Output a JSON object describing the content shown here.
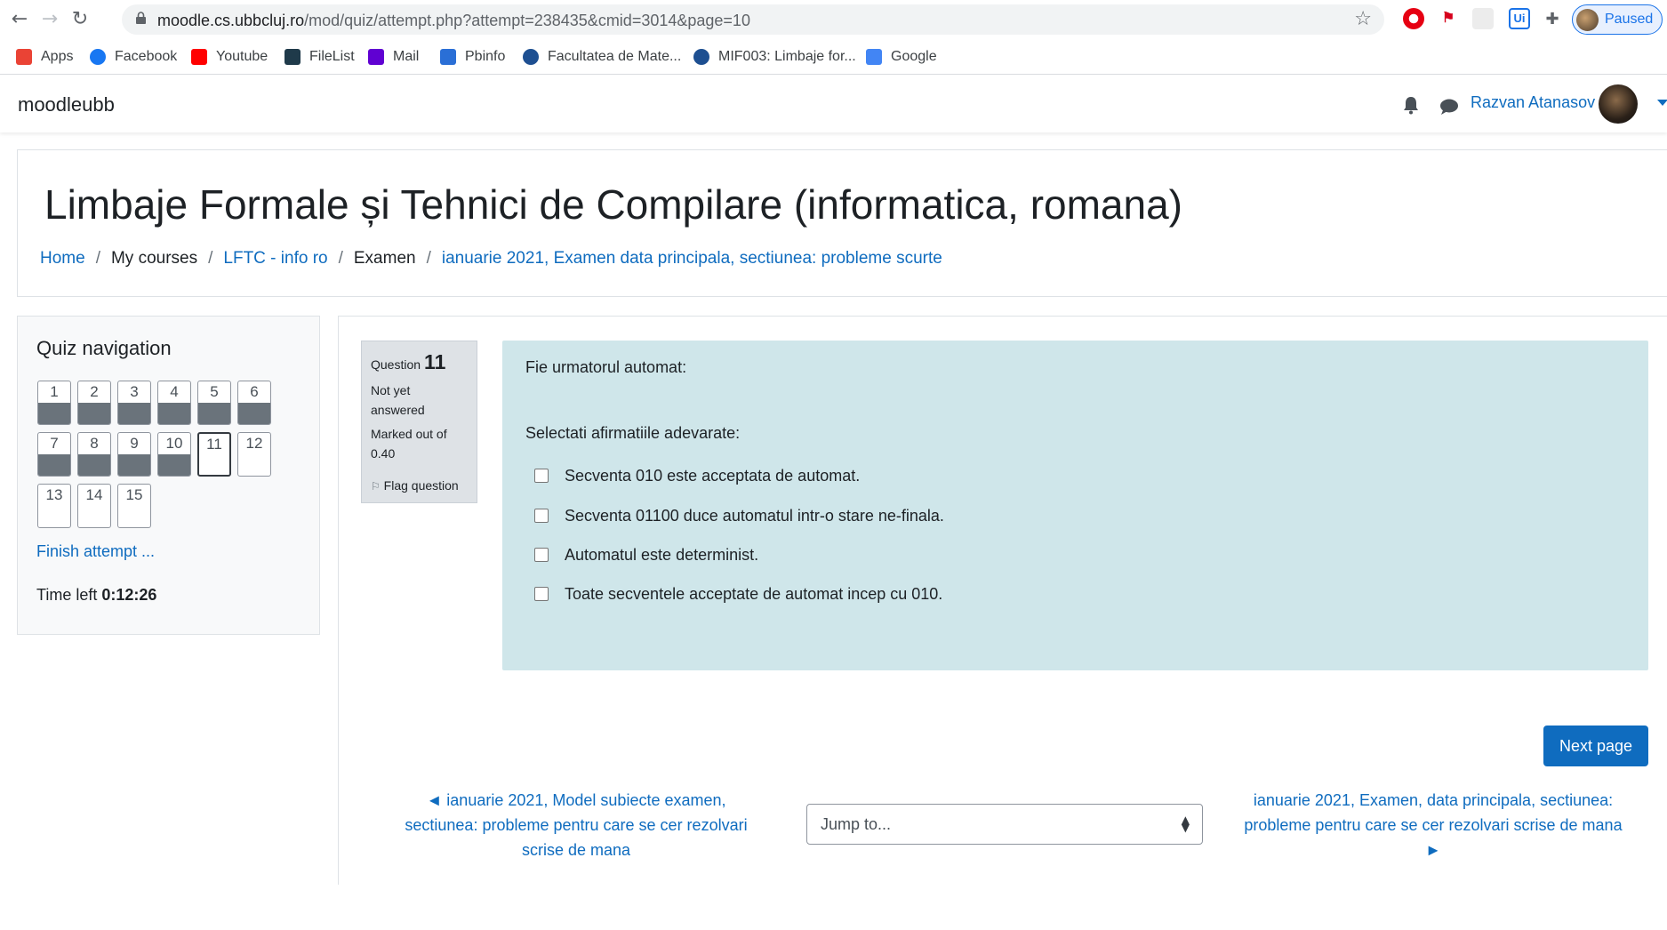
{
  "browser": {
    "url_host": "moodle.cs.ubbcluj.ro",
    "url_path": "/mod/quiz/attempt.php?attempt=238435&cmid=3014&page=10",
    "profile_status": "Paused",
    "bookmarks": [
      {
        "label": "Apps",
        "icon": "apps-grid-icon",
        "color": "#ea4335"
      },
      {
        "label": "Facebook",
        "icon": "facebook-icon",
        "color": "#1877f2"
      },
      {
        "label": "Youtube",
        "icon": "youtube-icon",
        "color": "#ff0000"
      },
      {
        "label": "FileList",
        "icon": "filelist-icon",
        "color": "#1f3a4a"
      },
      {
        "label": "Mail",
        "icon": "mail-icon",
        "color": "#6001d2"
      },
      {
        "label": "Pbinfo",
        "icon": "pbinfo-icon",
        "color": "#2a6fd6"
      },
      {
        "label": "Facultatea de Mate...",
        "icon": "university-icon",
        "color": "#1d4f91"
      },
      {
        "label": "MIF003: Limbaje for...",
        "icon": "university-icon",
        "color": "#1d4f91"
      },
      {
        "label": "Google",
        "icon": "google-icon",
        "color": "#4285f4"
      }
    ]
  },
  "navbar": {
    "brand": "moodleubb",
    "user_name": "Razvan Atanasov"
  },
  "header": {
    "course_title": "Limbaje Formale și Tehnici de Compilare (informatica, romana)",
    "breadcrumb": [
      {
        "label": "Home",
        "link": true
      },
      {
        "label": "My courses",
        "link": false
      },
      {
        "label": "LFTC - info ro",
        "link": true
      },
      {
        "label": "Examen",
        "link": false
      },
      {
        "label": "ianuarie 2021, Examen data principala, sectiunea: probleme scurte",
        "link": true
      }
    ]
  },
  "quiz_nav": {
    "title": "Quiz navigation",
    "buttons": [
      {
        "num": "1",
        "answered": true
      },
      {
        "num": "2",
        "answered": true
      },
      {
        "num": "3",
        "answered": true
      },
      {
        "num": "4",
        "answered": true
      },
      {
        "num": "5",
        "answered": true
      },
      {
        "num": "6",
        "answered": true
      },
      {
        "num": "7",
        "answered": true
      },
      {
        "num": "8",
        "answered": true
      },
      {
        "num": "9",
        "answered": true
      },
      {
        "num": "10",
        "answered": true
      },
      {
        "num": "11",
        "answered": false,
        "current": true
      },
      {
        "num": "12",
        "answered": false
      },
      {
        "num": "13",
        "answered": false
      },
      {
        "num": "14",
        "answered": false
      },
      {
        "num": "15",
        "answered": false
      }
    ],
    "finish_label": "Finish attempt ...",
    "time_left_label": "Time left",
    "time_left_value": "0:12:26"
  },
  "question": {
    "label": "Question",
    "number": "11",
    "state": "Not yet answered",
    "marked_out_of": "Marked out of 0.40",
    "flag_label": "Flag question",
    "intro": "Fie urmatorul automat:",
    "prompt": "Selectati afirmatiile adevarate:",
    "options": [
      "Secventa 010 este acceptata de automat.",
      "Secventa 01100 duce automatul intr-o stare ne-finala.",
      "Automatul este determinist.",
      "Toate secventele acceptate de automat incep cu 010."
    ]
  },
  "footer_nav": {
    "next_page_label": "Next page",
    "prev_activity": "◄ ianuarie 2021, Model subiecte examen, sectiunea: probleme pentru care se cer rezolvari scrise de mana",
    "jump_placeholder": "Jump to...",
    "next_activity": "ianuarie 2021, Examen, data principala, sectiunea: probleme pentru care se cer rezolvari scrise de mana ►"
  },
  "colors": {
    "link": "#0f6cbf",
    "question_bg": "#cfe6ea",
    "answered_bar": "#6a737b"
  }
}
